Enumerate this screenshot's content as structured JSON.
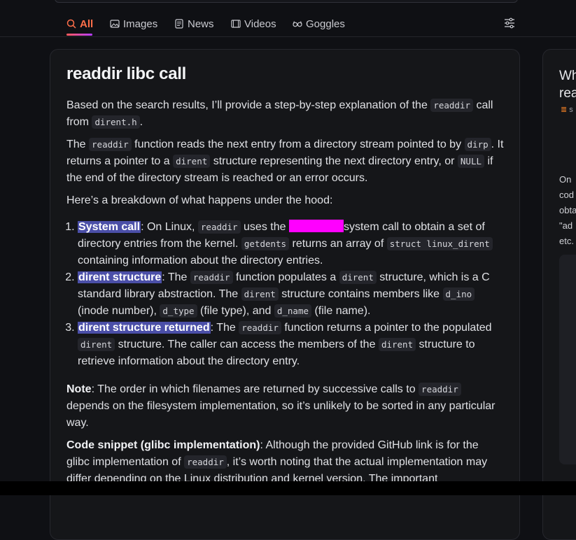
{
  "tabs": [
    {
      "label": "All",
      "icon": "search-icon",
      "active": true
    },
    {
      "label": "Images",
      "icon": "image-icon"
    },
    {
      "label": "News",
      "icon": "news-icon"
    },
    {
      "label": "Videos",
      "icon": "film-icon"
    },
    {
      "label": "Goggles",
      "icon": "goggles-icon"
    }
  ],
  "accent_color": "#ff6f4a",
  "summary": {
    "title": "readdir libc call",
    "intro_1": "Based on the search results, I’ll provide a step-by-step explanation of the",
    "intro_code_1": "readdir",
    "intro_2": "call from",
    "intro_code_2": "dirent.h",
    "intro_3": ".",
    "p2_1": "The",
    "p2_code_1": "readdir",
    "p2_2": "function reads the next entry from a directory stream pointed to by",
    "p2_code_2": "dirp",
    "p2_3": ". It returns a pointer to a",
    "p2_code_3": "dirent",
    "p2_4": "structure representing the next directory entry, or",
    "p2_code_4": "NULL",
    "p2_5": "if the end of the directory stream is reached or an error occurs.",
    "p3": "Here’s a breakdown of what happens under the hood:",
    "steps": [
      {
        "label": "System call",
        "t1": ": On Linux,",
        "c1": "readdir",
        "t2": "uses the",
        "t3": "system call to obtain a set of directory entries from the kernel.",
        "c2": "getdents",
        "t4": "returns an array of",
        "c3": "struct linux_dirent",
        "t5": "containing information about the directory entries."
      },
      {
        "label": "dirent structure",
        "t1": ": The",
        "c1": "readdir",
        "t2": "function populates a",
        "c2": "dirent",
        "t3": "structure, which is a C standard library abstraction. The",
        "c3": "dirent",
        "t4": "structure contains members like",
        "c4": "d_ino",
        "t5": "(inode number),",
        "c5": "d_type",
        "t6": "(file type), and",
        "c6": "d_name",
        "t7": "(file name)."
      },
      {
        "label": "dirent structure returned",
        "t1": ": The",
        "c1": "readdir",
        "t2": "function returns a pointer to the populated",
        "c2": "dirent",
        "t3": "structure. The caller can access the members of the",
        "c3": "dirent",
        "t4": "structure to retrieve information about the directory entry."
      }
    ],
    "note_label": "Note",
    "note_1": ": The order in which filenames are returned by successive calls to",
    "note_code": "readdir",
    "note_2": "depends on the filesystem implementation, so it’s unlikely to be sorted in any particular way.",
    "snippet_label": "Code snippet (glibc implementation)",
    "snippet_1": ": Although the provided GitHub link is for the glibc implementation of",
    "snippet_code": "readdir",
    "snippet_2": ", it’s worth noting that the actual implementation may differ depending on the Linux distribution and kernel version. The important"
  },
  "side_panel": {
    "title_1": "Wh",
    "title_2": "rea",
    "meta": "s",
    "text": [
      "On",
      "cod",
      "obta",
      "\"ad",
      "etc."
    ]
  }
}
